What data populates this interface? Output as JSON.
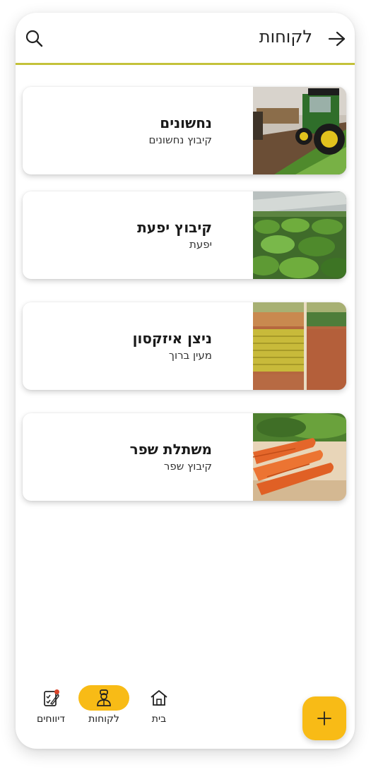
{
  "header": {
    "title": "לקוחות",
    "back_icon": "arrow-right-icon",
    "search_icon": "search-icon"
  },
  "customers": [
    {
      "name": "נחשונים",
      "subtitle": "קיבוץ נחשונים",
      "image": "tractor-field-image"
    },
    {
      "name": "קיבוץ יפעת",
      "subtitle": "יפעת",
      "image": "greenhouse-crops-image"
    },
    {
      "name": "ניצן איזקסון",
      "subtitle": "מעין ברוך",
      "image": "aerial-fields-image"
    },
    {
      "name": "משתלת שפר",
      "subtitle": "קיבוץ שפר",
      "image": "carrots-image"
    }
  ],
  "nav": {
    "home_label": "בית",
    "customers_label": "לקוחות",
    "reports_label": "דיווחים",
    "active": "customers"
  },
  "fab": {
    "icon": "plus-icon"
  },
  "colors": {
    "accent": "#f8bb16",
    "divider": "#c4c23a",
    "notification": "#d9442a"
  }
}
